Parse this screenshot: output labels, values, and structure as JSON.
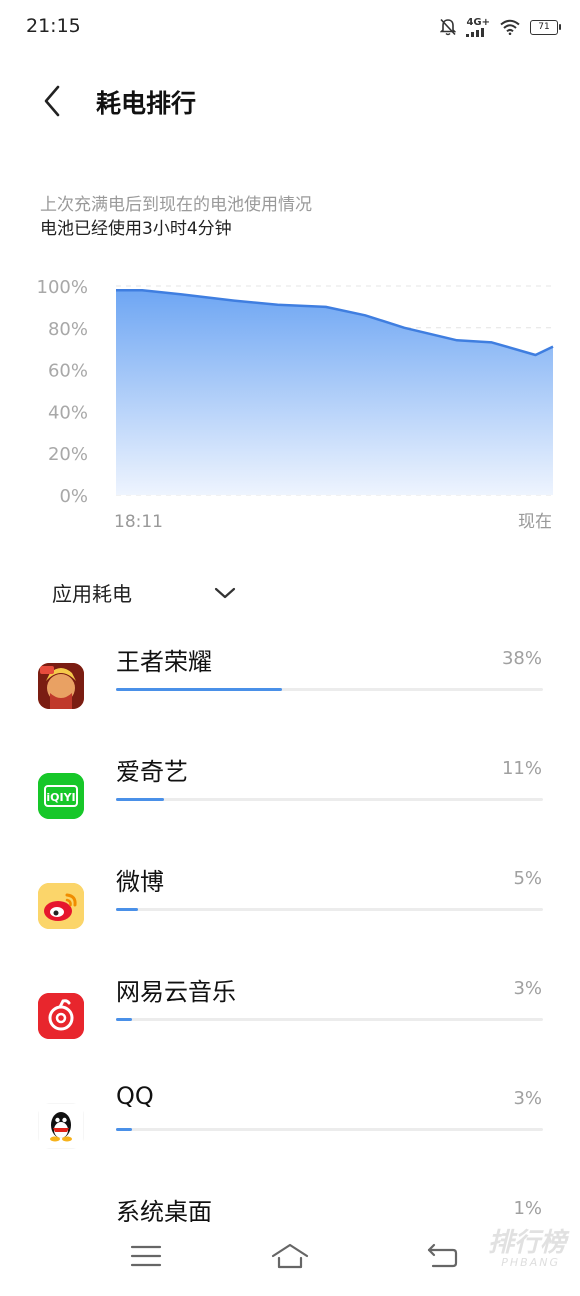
{
  "status_bar": {
    "time": "21:15",
    "network": "4G+",
    "battery_level": "71",
    "icons": [
      "alarm-off-icon",
      "signal-icon",
      "wifi-icon",
      "battery-icon"
    ]
  },
  "header": {
    "back_icon": "chevron-left-icon",
    "title": "耗电排行"
  },
  "summary": {
    "caption": "上次充满电后到现在的电池使用情况",
    "used": "电池已经使用3小时4分钟"
  },
  "chart_data": {
    "type": "area",
    "y_tick_labels": [
      "100%",
      "80%",
      "60%",
      "40%",
      "20%",
      "0%"
    ],
    "x_tick_labels": [
      "18:11",
      "现在"
    ],
    "ylim": [
      0,
      100
    ],
    "x": [
      0,
      0.06,
      0.15,
      0.27,
      0.37,
      0.48,
      0.57,
      0.66,
      0.78,
      0.86,
      0.96,
      1.0
    ],
    "values": [
      98,
      98,
      96,
      93,
      91,
      90,
      86,
      80,
      74,
      73,
      67,
      71
    ],
    "line_color": "#3f7ee0",
    "fill_top_color": "#6ea6f3",
    "fill_bottom_color": "#eef4fe",
    "grid": true
  },
  "section": {
    "title": "应用耗电",
    "dropdown_icon": "chevron-down-icon"
  },
  "apps": [
    {
      "name": "王者荣耀",
      "percent_label": "38%",
      "usage": 0.38,
      "icon": "honor-of-kings-icon",
      "color": "#c8481c"
    },
    {
      "name": "爱奇艺",
      "percent_label": "11%",
      "usage": 0.11,
      "icon": "iqiyi-icon",
      "color": "#18c92a",
      "icon_text": "iQIYI"
    },
    {
      "name": "微博",
      "percent_label": "5%",
      "usage": 0.05,
      "icon": "weibo-icon",
      "color": "#f9c93a"
    },
    {
      "name": "网易云音乐",
      "percent_label": "3%",
      "usage": 0.03,
      "icon": "netease-music-icon",
      "color": "#e8262d"
    },
    {
      "name": "QQ",
      "percent_label": "3%",
      "usage": 0.03,
      "icon": "qq-icon",
      "color": "#ffffff"
    },
    {
      "name": "系统桌面",
      "percent_label": "1%",
      "usage": 0.01,
      "icon": "launcher-icon",
      "color": "#f6c91b"
    }
  ],
  "bottom_nav": {
    "icons": [
      "menu-icon",
      "home-icon",
      "back-icon"
    ]
  },
  "watermark": {
    "text": "排行榜",
    "sub": "PHBANG"
  }
}
